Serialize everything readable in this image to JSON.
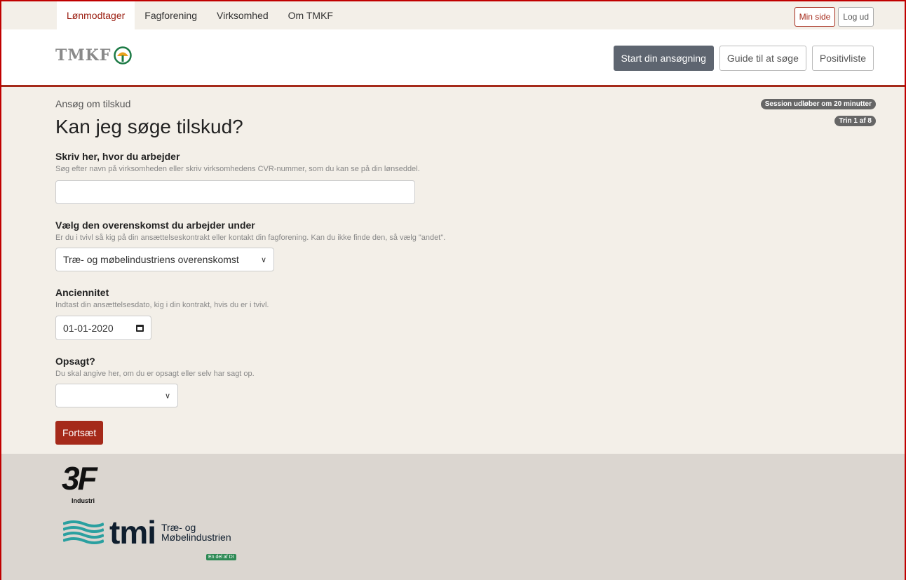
{
  "topnav": {
    "items": [
      {
        "label": "Lønmodtager"
      },
      {
        "label": "Fagforening"
      },
      {
        "label": "Virksomhed"
      },
      {
        "label": "Om TMKF"
      }
    ],
    "my_page": "Min side",
    "logout": "Log ud"
  },
  "header": {
    "logo": "TMKF",
    "buttons": {
      "start": "Start din ansøgning",
      "guide": "Guide til at søge",
      "positive_list": "Positivliste"
    }
  },
  "main": {
    "breadcrumb": "Ansøg om tilskud",
    "session_badge": "Session udløber om 20 minutter",
    "step_badge": "Trin 1 af 8",
    "title": "Kan jeg søge tilskud?",
    "workplace": {
      "label": "Skriv her, hvor du arbejder",
      "help": "Søg efter navn på virksomheden eller skriv virksomhedens CVR-nummer, som du kan se på din lønseddel.",
      "value": ""
    },
    "agreement": {
      "label": "Vælg den overenskomst du arbejder under",
      "help": "Er du i tvivl så kig på din ansættelseskontrakt eller kontakt din fagforening. Kan du ikke finde den, så vælg \"andet\".",
      "value": "Træ- og møbelindustriens overenskomst"
    },
    "seniority": {
      "label": "Anciennitet",
      "help": "Indtast din ansættelsesdato, kig i din kontrakt, hvis du er i tvivl.",
      "value": "01-01-2020"
    },
    "dismissed": {
      "label": "Opsagt?",
      "help": "Du skal angive her, om du er opsagt eller selv har sagt op.",
      "value": ""
    },
    "submit": "Fortsæt"
  },
  "footer": {
    "logo_3f": "3F",
    "logo_3f_sub": "Industri",
    "tmi_word": "tmi",
    "tmi_line1": "Træ- og",
    "tmi_line2": "Møbelindustrien",
    "tmi_tag": "En del af DI"
  },
  "colors": {
    "accent": "#a52a1a",
    "background": "#f3efe8",
    "footer": "#dbd6d0",
    "primary_button": "#5e6570"
  }
}
